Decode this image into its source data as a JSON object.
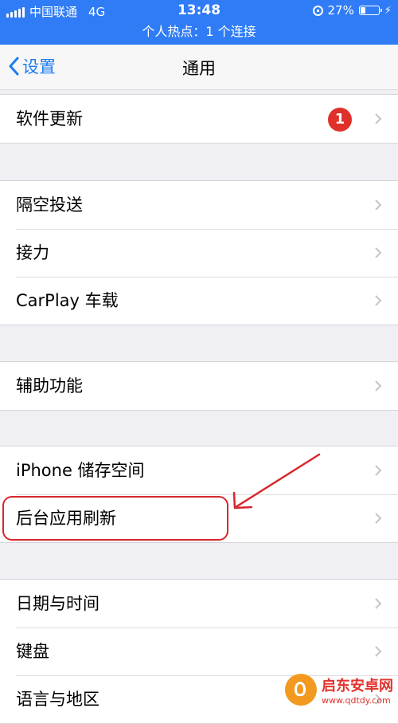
{
  "status_bar": {
    "carrier": "中国联通",
    "network": "4G",
    "time": "13:48",
    "battery_percent_text": "27%",
    "battery_level": 0.27,
    "hotspot_text": "个人热点：1 个连接",
    "color": "#2f7cf6"
  },
  "nav": {
    "back_label": "设置",
    "title": "通用",
    "accent": "#1e7cf2"
  },
  "groups": [
    {
      "rows": [
        {
          "label": "软件更新",
          "badge": "1"
        }
      ]
    },
    {
      "rows": [
        {
          "label": "隔空投送"
        },
        {
          "label": "接力"
        },
        {
          "label": "CarPlay 车载"
        }
      ]
    },
    {
      "rows": [
        {
          "label": "辅助功能"
        }
      ]
    },
    {
      "rows": [
        {
          "label": "iPhone 储存空间"
        },
        {
          "label": "后台应用刷新"
        }
      ]
    },
    {
      "rows": [
        {
          "label": "日期与时间"
        },
        {
          "label": "键盘"
        },
        {
          "label": "语言与地区"
        }
      ]
    }
  ],
  "watermark": {
    "name": "启东安卓网",
    "url": "www.qdtdy.com"
  },
  "icons": [
    "signal-icon",
    "lock-rotation-icon",
    "battery-icon",
    "charging-bolt-icon",
    "chevron-left-icon",
    "chevron-right-icon",
    "annotation-arrow-icon"
  ]
}
